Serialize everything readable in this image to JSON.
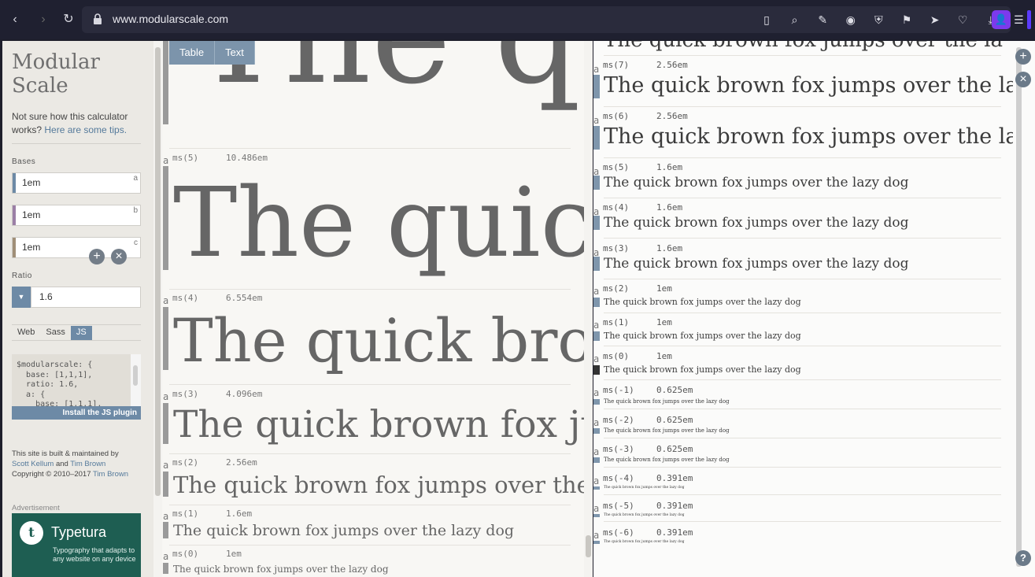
{
  "browser": {
    "url": "www.modularscale.com",
    "nav": {
      "back": "‹",
      "forward": "›",
      "reload": "↻"
    },
    "toolbar_icons": [
      "reader-icon",
      "zoom-icon",
      "edit-icon",
      "camera-icon",
      "shield-icon",
      "translate-icon",
      "send-icon",
      "heart-icon",
      "download-icon",
      "menu-icon"
    ],
    "toolbar_glyphs": [
      "▯",
      "⌕",
      "✎",
      "◉",
      "⛨",
      "⚑",
      "➤",
      "♡",
      "⤓",
      "☰"
    ],
    "profile_glyph": "👤"
  },
  "sidebar": {
    "brand_line1": "Modular",
    "brand_line2": "Scale",
    "tips_text": "Not sure how this calculator works?",
    "tips_link": "Here are some tips.",
    "bases_label": "Bases",
    "bases": [
      {
        "value": "1em",
        "tag": "a",
        "color": "#6d8aa6"
      },
      {
        "value": "1em",
        "tag": "b",
        "color": "#9b7fa6"
      },
      {
        "value": "1em",
        "tag": "c",
        "color": "#a08f78"
      }
    ],
    "add_glyph": "+",
    "remove_glyph": "×",
    "ratio_label": "Ratio",
    "ratio_value": "1.6",
    "output_tabs": [
      "Web",
      "Sass",
      "JS"
    ],
    "active_tab": "JS",
    "code": "$modularscale: {\n  base: [1,1,1],\n  ratio: 1.6,\n  a: {\n    base: [1,1,1],",
    "install_label": "Install the JS plugin",
    "credits_line1": "This site is built & maintained by",
    "credit_name1": "Scott Kellum",
    "credits_and": "and",
    "credit_name2": "Tim Brown",
    "credits_copy": "Copyright © 2010–2017",
    "credit_name3": "Tim Brown",
    "advert_label": "Advertisement",
    "ad_logo": "t",
    "ad_name": "Typetura",
    "ad_text": "Typography that adapts to any website on any device"
  },
  "middle": {
    "tabs": [
      "Table",
      "Text"
    ],
    "sample": "The quick brown fox jumps over the lazy dog",
    "top_partial": "The q",
    "rows": [
      {
        "step": "ms(5)",
        "size": "10.486em",
        "text": "The quick"
      },
      {
        "step": "ms(4)",
        "size": "6.554em",
        "text": "The quick brow"
      },
      {
        "step": "ms(3)",
        "size": "4.096em",
        "text": "The quick brown fox jum"
      },
      {
        "step": "ms(2)",
        "size": "2.56em",
        "text": "The quick brown fox jumps over the la"
      },
      {
        "step": "ms(1)",
        "size": "1.6em",
        "text": "The quick brown fox jumps over the lazy dog"
      },
      {
        "step": "ms(0)",
        "size": "1em",
        "text": "The quick brown fox jumps over the lazy dog"
      }
    ]
  },
  "right": {
    "top_partial": "The quick brown fox jumps over the la",
    "rows": [
      {
        "step": "ms(7)",
        "size": "2.56em",
        "text": "The quick brown fox jumps over the la"
      },
      {
        "step": "ms(6)",
        "size": "2.56em",
        "text": "The quick brown fox jumps over the la"
      },
      {
        "step": "ms(5)",
        "size": "1.6em",
        "text": "The quick brown fox jumps over the lazy dog"
      },
      {
        "step": "ms(4)",
        "size": "1.6em",
        "text": "The quick brown fox jumps over the lazy dog"
      },
      {
        "step": "ms(3)",
        "size": "1.6em",
        "text": "The quick brown fox jumps over the lazy dog"
      },
      {
        "step": "ms(2)",
        "size": "1em",
        "text": "The quick brown fox jumps over the lazy dog"
      },
      {
        "step": "ms(1)",
        "size": "1em",
        "text": "The quick brown fox jumps over the lazy dog"
      },
      {
        "step": "ms(0)",
        "size": "1em",
        "text": "The quick brown fox jumps over the lazy dog"
      },
      {
        "step": "ms(-1)",
        "size": "0.625em",
        "text": "The quick brown fox jumps over the lazy dog"
      },
      {
        "step": "ms(-2)",
        "size": "0.625em",
        "text": "The quick brown fox jumps over the lazy dog"
      },
      {
        "step": "ms(-3)",
        "size": "0.625em",
        "text": "The quick brown fox jumps over the lazy dog"
      },
      {
        "step": "ms(-4)",
        "size": "0.391em",
        "text": "The quick brown fox jumps over the lazy dog"
      },
      {
        "step": "ms(-5)",
        "size": "0.391em",
        "text": "The quick brown fox jumps over the lazy dog"
      },
      {
        "step": "ms(-6)",
        "size": "0.391em",
        "text": "The quick brown fox jumps over the lazy dog"
      }
    ],
    "help_glyph": "?"
  },
  "a_marker": "a"
}
